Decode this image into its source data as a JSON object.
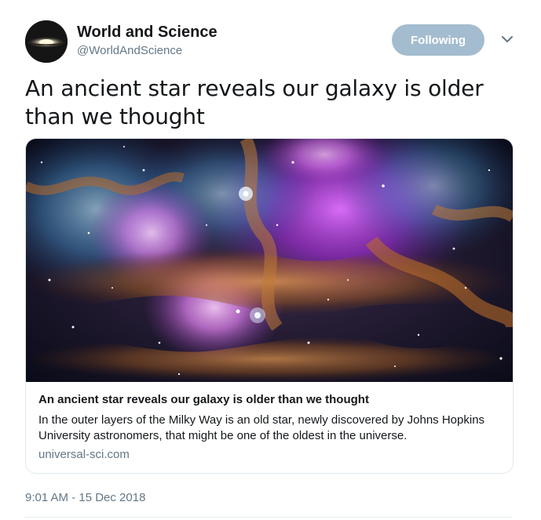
{
  "author": {
    "display_name": "World and Science",
    "handle": "@WorldAndScience",
    "avatar_icon": "galaxy-avatar-icon"
  },
  "follow_button": {
    "label": "Following",
    "color": "#a4bccf"
  },
  "more_icon": "chevron-down-icon",
  "tweet": {
    "text": "An ancient star reveals our galaxy is older than we thought"
  },
  "card": {
    "image_icon": "nebula-image",
    "title": "An ancient star reveals our galaxy is older than we thought",
    "description": "In the outer layers of the Milky Way is an old star, newly discovered by Johns Hopkins University astronomers, that might be one of the oldest in the universe.",
    "domain": "universal-sci.com"
  },
  "timestamp": "9:01 AM - 15 Dec 2018"
}
